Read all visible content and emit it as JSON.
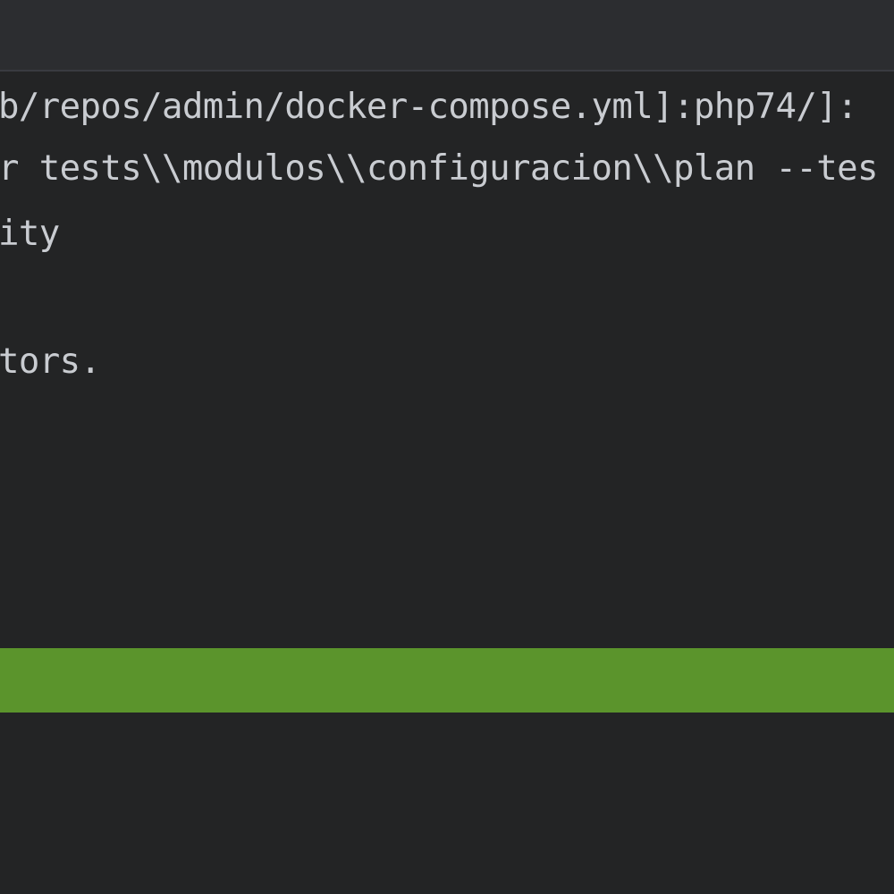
{
  "console": {
    "lines": [
      "b/repos/admin/docker-compose.yml]:php74/]:",
      "r tests\\\\modulos\\\\configuracion\\\\plan --tes",
      "ity",
      "tors."
    ]
  },
  "status_bar": {
    "color": "#5b942c",
    "state": "tests-passed"
  },
  "colors": {
    "background": "#232425",
    "text": "#c9ccd1",
    "toolbar": "#2c2d30"
  }
}
